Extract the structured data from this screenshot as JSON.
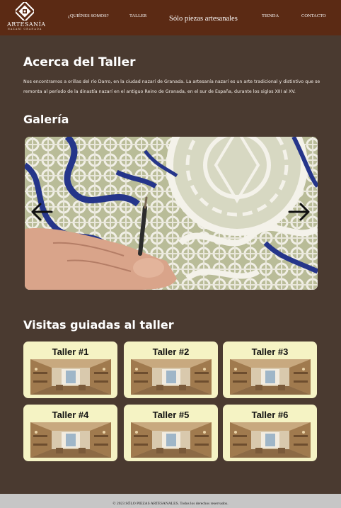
{
  "header": {
    "logo": {
      "name": "ARTESANÍA",
      "subtitle": "NAZARÍ GRANADA"
    },
    "nav": {
      "quienes": "¿QUIÉNES SOMOS?",
      "taller": "TALLER",
      "brand": "Sólo piezas artesanales",
      "tienda": "TIENDA",
      "contacto": "CONTACTO"
    }
  },
  "about": {
    "title": "Acerca del Taller",
    "text": "Nos encontramos a orillas del río Darro, en la ciudad nazarí de Granada. La artesanía nazarí es un arte tradicional y distintivo que se remonta al período de la dinastía nazarí en el antiguo Reino de Granada, en el sur de España, durante los siglos XIII al XV."
  },
  "gallery": {
    "title": "Galería",
    "prev_icon": "arrow-left-icon",
    "next_icon": "arrow-right-icon"
  },
  "visits": {
    "title": "Visitas guiadas al taller",
    "cards": [
      {
        "title": "Taller #1"
      },
      {
        "title": "Taller #2"
      },
      {
        "title": "Taller #3"
      },
      {
        "title": "Taller #4"
      },
      {
        "title": "Taller #5"
      },
      {
        "title": "Taller #6"
      }
    ]
  },
  "footer": {
    "text": "© 2023 SÓLO PIEZAS ARTESANALES. Todos los derechos reservados."
  },
  "colors": {
    "header_bg": "#5b2a14",
    "page_bg": "#4a3a30",
    "card_bg": "#f5f3c4",
    "footer_bg": "#c6c6c6"
  }
}
